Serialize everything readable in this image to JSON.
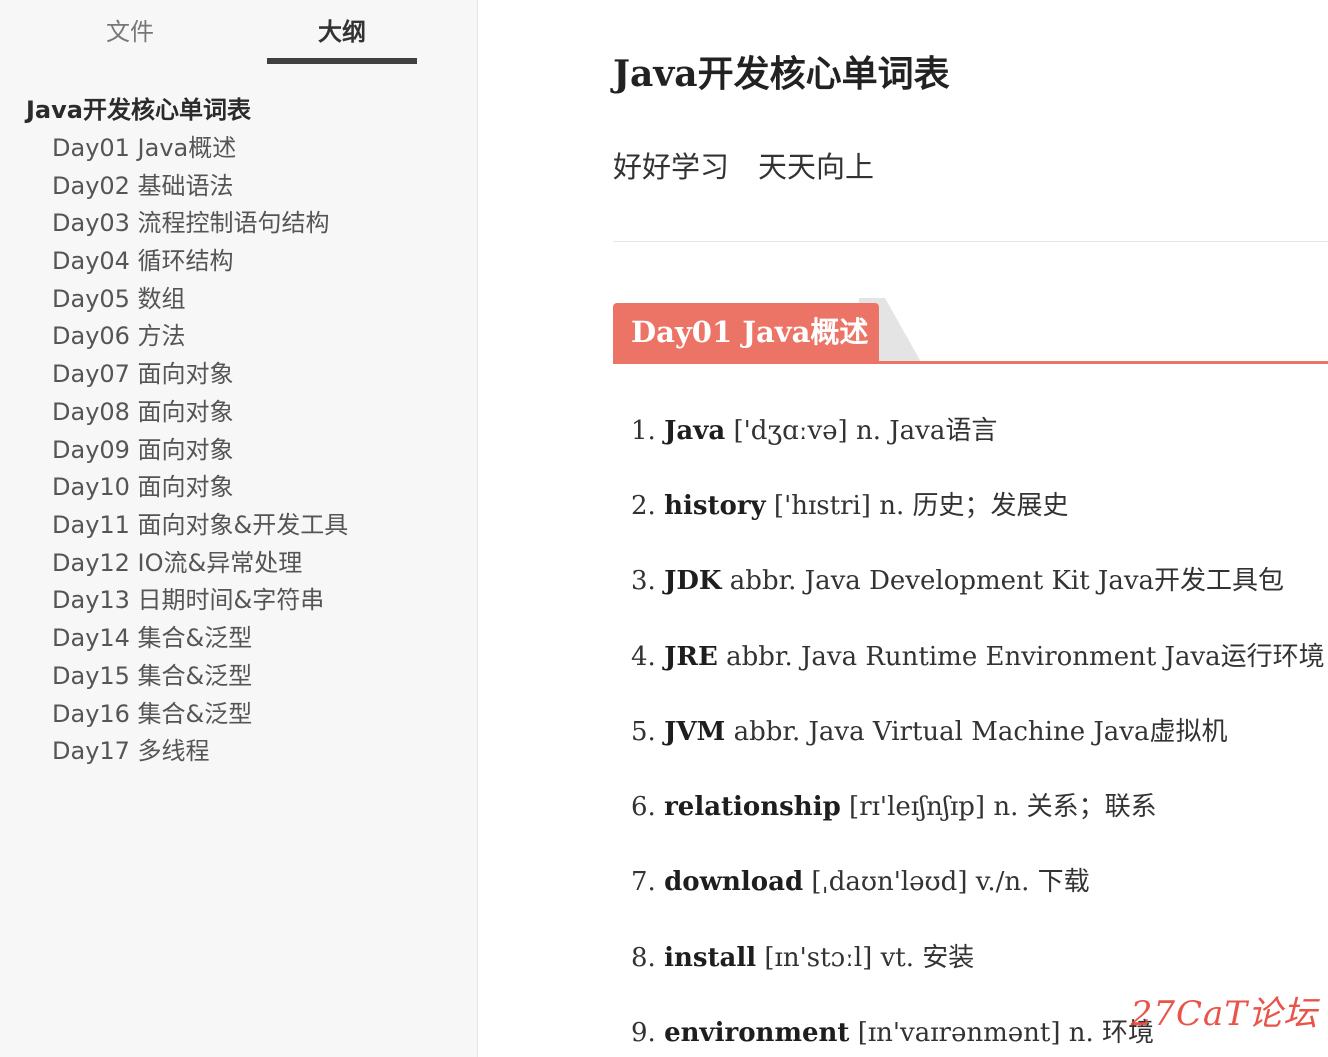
{
  "sidebar": {
    "tabs": [
      {
        "label": "文件",
        "active": false
      },
      {
        "label": "大纲",
        "active": true
      }
    ],
    "outline_root": "Java开发核心单词表",
    "outline_items": [
      "Day01 Java概述",
      "Day02 基础语法",
      "Day03 流程控制语句结构",
      "Day04 循环结构",
      "Day05 数组",
      "Day06 方法",
      "Day07 面向对象",
      "Day08 面向对象",
      "Day09 面向对象",
      "Day10 面向对象",
      "Day11 面向对象&开发工具",
      "Day12 IO流&异常处理",
      "Day13 日期时间&字符串",
      "Day14 集合&泛型",
      "Day15 集合&泛型",
      "Day16 集合&泛型",
      "Day17 多线程"
    ]
  },
  "document": {
    "title": "Java开发核心单词表",
    "subtitle": "好好学习　天天向上",
    "section_heading": "Day01 Java概述",
    "accent_color": "#ec7466",
    "vocabulary": [
      {
        "num": "1.",
        "term": "Java",
        "rest": "['dʒɑːvə] n. Java语言"
      },
      {
        "num": "2.",
        "term": "history",
        "rest": "['hɪstri] n. 历史；发展史"
      },
      {
        "num": "3.",
        "term": "JDK",
        "rest": "abbr. Java Development Kit Java开发工具包"
      },
      {
        "num": "4.",
        "term": "JRE",
        "rest": "abbr. Java Runtime Environment Java运行环境"
      },
      {
        "num": "5.",
        "term": "JVM",
        "rest": "abbr. Java Virtual Machine Java虚拟机"
      },
      {
        "num": "6.",
        "term": "relationship",
        "rest": "[rɪ'leɪʃnʃɪp] n. 关系；联系"
      },
      {
        "num": "7.",
        "term": "download",
        "rest": "[ˌdaʊn'ləʊd] v./n. 下载"
      },
      {
        "num": "8.",
        "term": "install",
        "rest": "[ɪn'stɔːl] vt. 安装"
      },
      {
        "num": "9.",
        "term": "environment",
        "rest": "[ɪn'vaɪrənmənt] n. 环境"
      }
    ]
  },
  "watermark": "27CaT论坛"
}
